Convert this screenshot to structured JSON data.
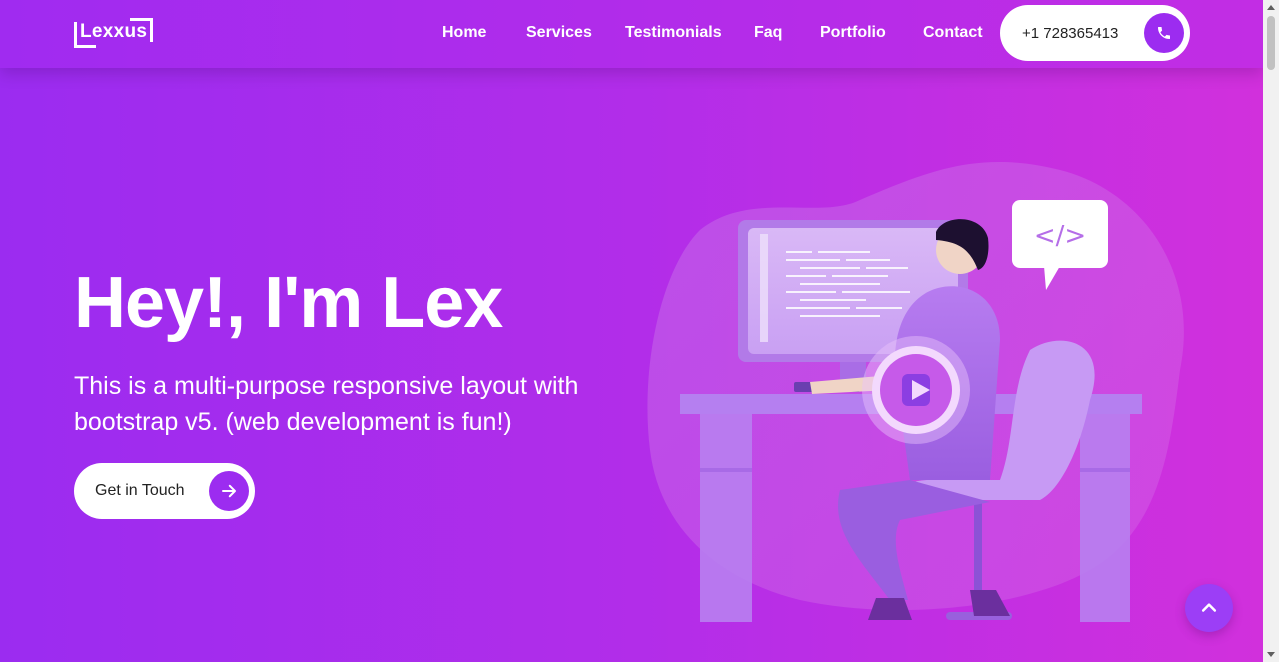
{
  "header": {
    "logo_text": "Lexxus",
    "nav": [
      {
        "label": "Home"
      },
      {
        "label": "Services"
      },
      {
        "label": "Testimonials"
      },
      {
        "label": "Faq"
      },
      {
        "label": "Portfolio"
      },
      {
        "label": "Contact"
      }
    ],
    "phone": "+1 728365413"
  },
  "hero": {
    "title": "Hey!, I'm Lex",
    "subtitle": "This is a multi-purpose responsive layout with bootstrap v5. (web development is fun!)",
    "cta_label": "Get in Touch",
    "speech_bubble_code": "</>"
  },
  "colors": {
    "accent": "#9c2cf0",
    "gradient_start": "#9b2cf0",
    "gradient_end": "#d230dc"
  },
  "icons": {
    "phone": "phone-icon",
    "cta": "arrow-right-icon",
    "scroll_top": "chevron-up-icon",
    "video": "play-icon"
  }
}
